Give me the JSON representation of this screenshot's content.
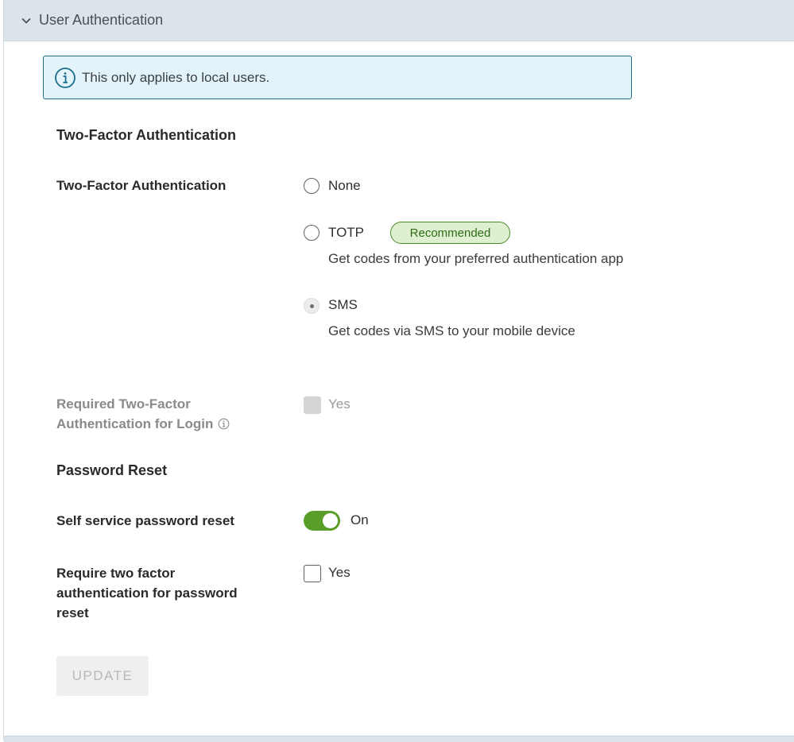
{
  "panel": {
    "title": "User Authentication",
    "expanded_icon": "chevron-down-icon"
  },
  "info_banner": {
    "icon": "info-icon",
    "text": "This only applies to local users."
  },
  "two_factor": {
    "section_heading": "Two-Factor Authentication",
    "field_label": "Two-Factor Authentication",
    "options": [
      {
        "label": "None",
        "description": "",
        "selected": false
      },
      {
        "label": "TOTP",
        "badge": "Recommended",
        "description": "Get codes from your preferred authentication app",
        "selected": false
      },
      {
        "label": "SMS",
        "description": "Get codes via SMS to your mobile device",
        "selected": true,
        "disabled": true
      }
    ],
    "required_label_line1": "Required Two-Factor",
    "required_label_line2": "Authentication for Login",
    "required_checkbox_label": "Yes",
    "required_checked": false,
    "required_disabled": true
  },
  "password_reset": {
    "section_heading": "Password Reset",
    "self_service_label": "Self service password reset",
    "self_service_state": "On",
    "self_service_on": true,
    "require_2fa_label_line1": "Require two factor",
    "require_2fa_label_line2": "authentication for password",
    "require_2fa_label_line3": "reset",
    "require_2fa_checkbox_label": "Yes",
    "require_2fa_checked": false
  },
  "actions": {
    "update_label": "UPDATE",
    "update_enabled": false
  },
  "colors": {
    "header_bg": "#dbe4ea",
    "banner_bg": "#e3f3fa",
    "banner_border": "#1a6e8e",
    "toggle_on": "#5a9e29",
    "badge_bg": "#dff0d0",
    "badge_border": "#4c8a2b"
  }
}
